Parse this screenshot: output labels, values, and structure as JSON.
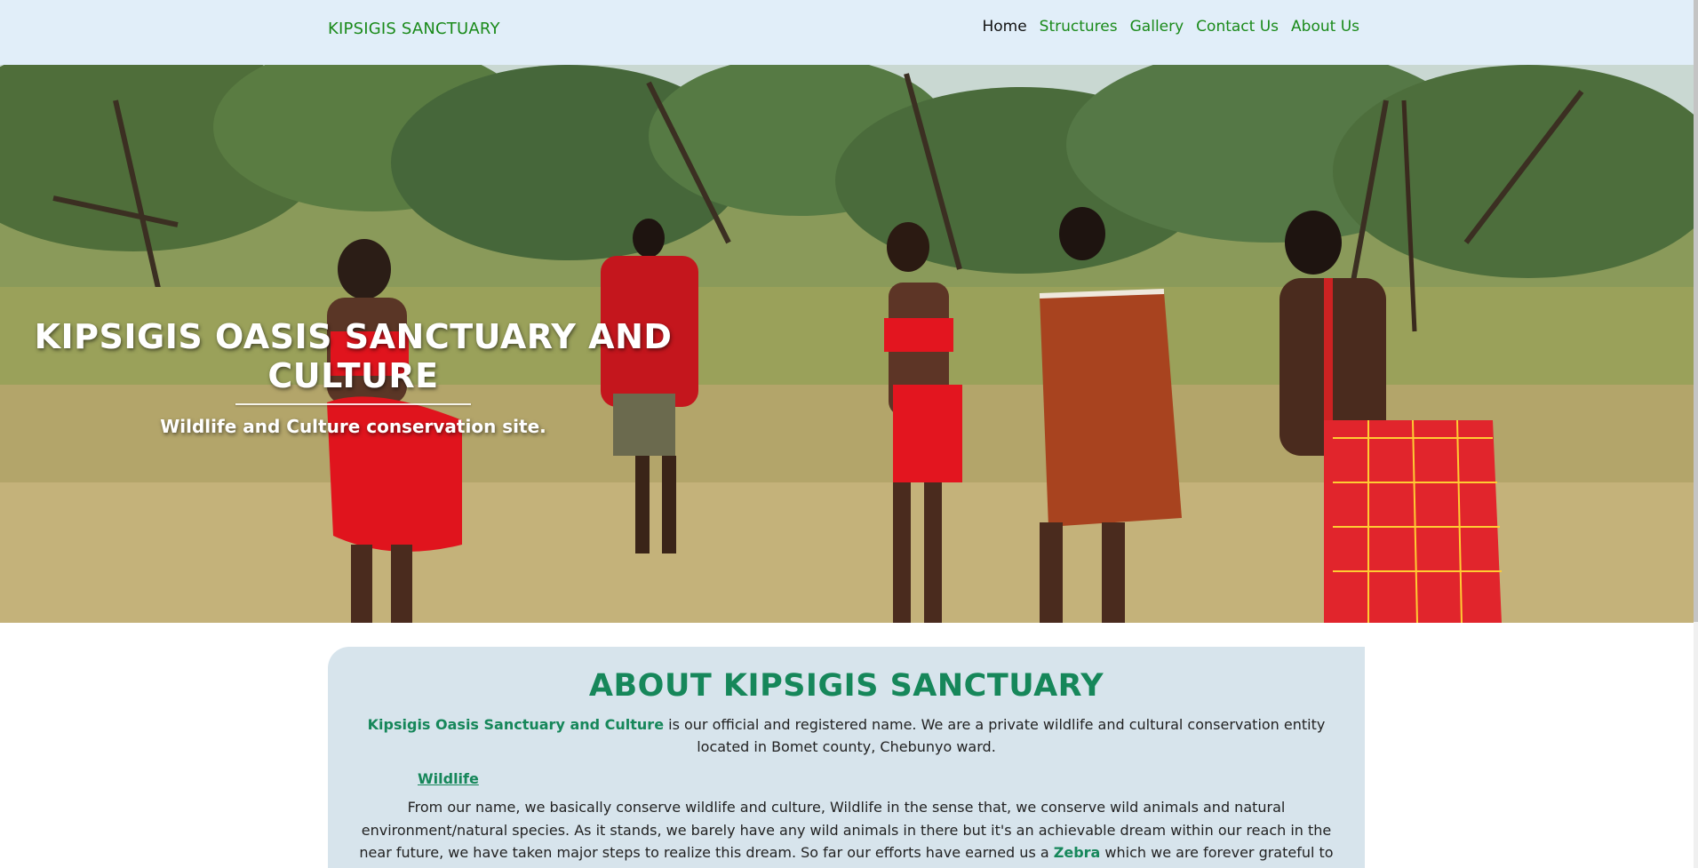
{
  "nav": {
    "brand": "KIPSIGIS SANCTUARY",
    "links": [
      {
        "label": "Home",
        "active": true
      },
      {
        "label": "Structures",
        "active": false
      },
      {
        "label": "Gallery",
        "active": false
      },
      {
        "label": "Contact Us",
        "active": false
      },
      {
        "label": "About Us",
        "active": false
      }
    ]
  },
  "hero": {
    "title": "KIPSIGIS OASIS SANCTUARY AND CULTURE",
    "subtitle": "Wildlife and Culture conservation site."
  },
  "about": {
    "heading": "ABOUT KIPSIGIS SANCTUARY",
    "intro_highlight": "Kipsigis Oasis Sanctuary and Culture",
    "intro_rest": " is our official and registered name. We are a private wildlife and cultural conservation entity located in Bomet county, Chebunyo ward.",
    "wildlife_link": "Wildlife",
    "body_before": "From our name, we basically conserve wildlife and culture, Wildlife in the sense that, we conserve wild animals and natural environment/natural species. As it stands, we barely have any wild animals in there but it's an achievable dream within our reach in the near future, we have taken major steps to realize this dream. So far our efforts have earned us a ",
    "body_highlight": "Zebra",
    "body_after": " which we are forever grateful to Kenya Wildlife Service for making this happen."
  },
  "colors": {
    "nav_bg": "#e1eef9",
    "brand_green": "#1a8a1a",
    "heading_green": "#16875a",
    "card_bg": "#d7e4ec"
  }
}
